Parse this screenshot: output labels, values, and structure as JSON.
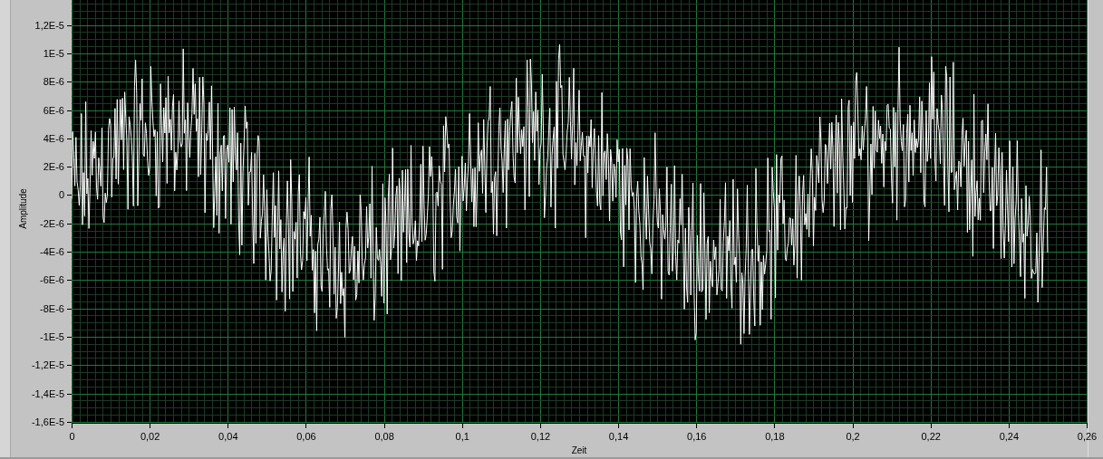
{
  "graph": {
    "y_axis": {
      "label": "Amplitude",
      "ticks": [
        "1,2E-5",
        "1E-5",
        "8E-6",
        "6E-6",
        "4E-6",
        "2E-6",
        "0",
        "-2E-6",
        "-4E-6",
        "-6E-6",
        "-8E-6",
        "-1E-5",
        "-1,2E-5",
        "-1,4E-5",
        "-1,6E-5"
      ]
    },
    "x_axis": {
      "label": "Zeit",
      "ticks": [
        "0",
        "0,02",
        "0,04",
        "0,06",
        "0,08",
        "0,1",
        "0,12",
        "0,14",
        "0,16",
        "0,18",
        "0,2",
        "0,22",
        "0,24",
        "0,26"
      ]
    }
  }
}
